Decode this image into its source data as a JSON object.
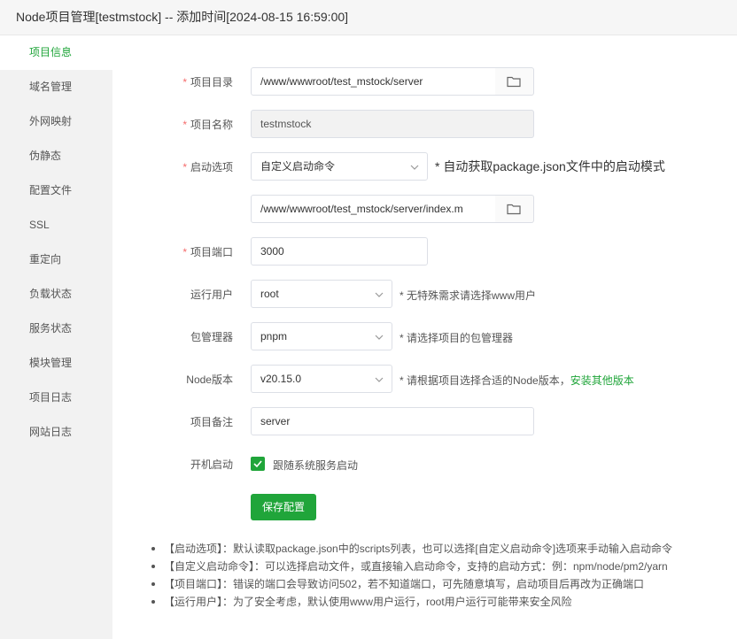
{
  "window": {
    "title": "Node项目管理[testmstock] -- 添加时间[2024-08-15 16:59:00]"
  },
  "sidebar": {
    "items": [
      {
        "label": "项目信息",
        "active": true
      },
      {
        "label": "域名管理"
      },
      {
        "label": "外网映射"
      },
      {
        "label": "伪静态"
      },
      {
        "label": "配置文件"
      },
      {
        "label": "SSL"
      },
      {
        "label": "重定向"
      },
      {
        "label": "负载状态"
      },
      {
        "label": "服务状态"
      },
      {
        "label": "模块管理"
      },
      {
        "label": "项目日志"
      },
      {
        "label": "网站日志"
      }
    ]
  },
  "form": {
    "required_mark": "*",
    "project_dir": {
      "label": "项目目录",
      "value": "/www/wwwroot/test_mstock/server"
    },
    "project_name": {
      "label": "项目名称",
      "value": "testmstock"
    },
    "start_option": {
      "label": "启动选项",
      "value": "自定义启动命令",
      "hint": "* 自动获取package.json文件中的启动模式"
    },
    "start_file": {
      "value": "/www/wwwroot/test_mstock/server/index.m"
    },
    "port": {
      "label": "项目端口",
      "value": "3000"
    },
    "run_user": {
      "label": "运行用户",
      "value": "root",
      "hint": "* 无特殊需求请选择www用户"
    },
    "pkg_manager": {
      "label": "包管理器",
      "value": "pnpm",
      "hint": "* 请选择项目的包管理器"
    },
    "node_version": {
      "label": "Node版本",
      "value": "v20.15.0",
      "hint": "* 请根据项目选择合适的Node版本，",
      "link": "安装其他版本"
    },
    "remark": {
      "label": "项目备注",
      "value": "server"
    },
    "autostart": {
      "label": "开机启动",
      "checkbox_label": "跟随系统服务启动",
      "checked": true
    },
    "save_label": "保存配置"
  },
  "notes": [
    "【启动选项】：默认读取package.json中的scripts列表，也可以选择[自定义启动命令]选项来手动输入启动命令",
    "【自定义启动命令】：可以选择启动文件，或直接输入启动命令，支持的启动方式：例：npm/node/pm2/yarn",
    "【项目端口】：错误的端口会导致访问502，若不知道端口，可先随意填写，启动项目后再改为正确端口",
    "【运行用户】：为了安全考虑，默认使用www用户运行，root用户运行可能带来安全风险"
  ],
  "colors": {
    "accent": "#20a53a",
    "required": "#f56c6c"
  }
}
